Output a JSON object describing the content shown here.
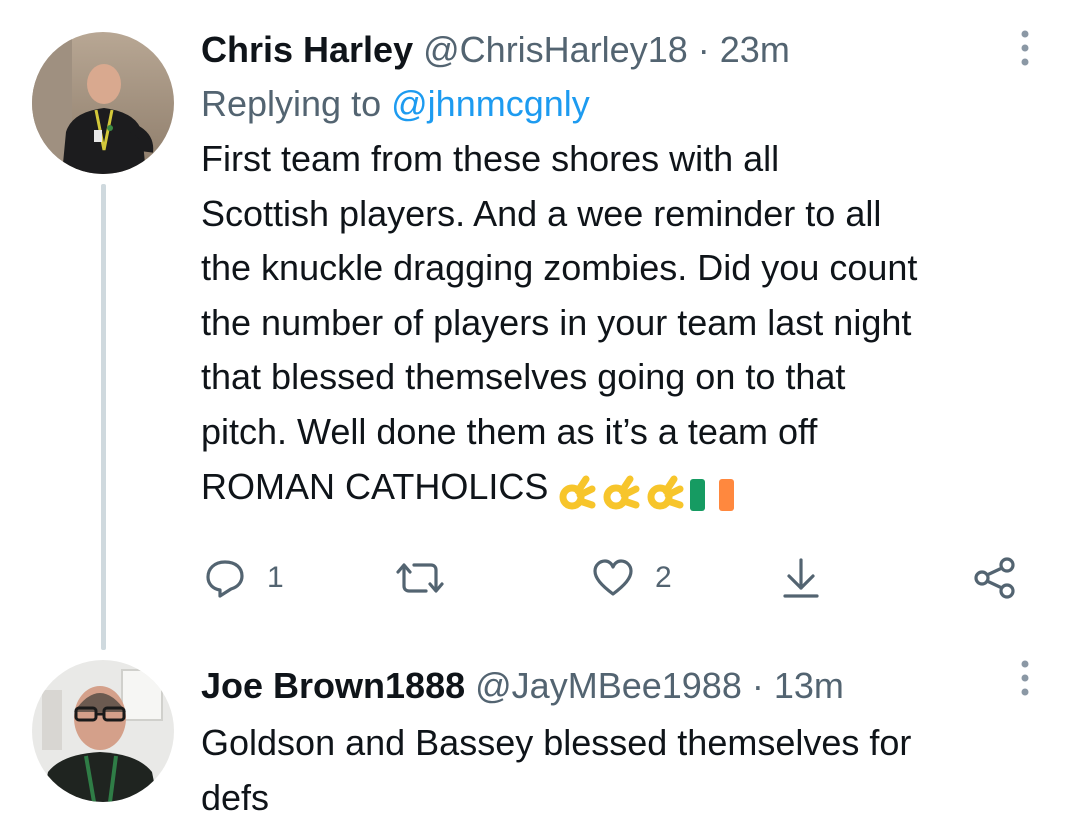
{
  "tweets": [
    {
      "display_name": "Chris Harley",
      "handle": "@ChrisHarley18",
      "separator": "·",
      "time": "23m",
      "replying_prefix": "Replying to",
      "replying_handle": "@jhnmcgnly",
      "text": "First team from these shores with all\nScottish players. And a wee reminder to all\nthe knuckle dragging zombies. Did you count\nthe number of players in your team last night\nthat blessed themselves going on to that\npitch. Well done them as it’s a team off\nROMAN CATHOLICS",
      "emojis": [
        "ok-hand-emoji",
        "ok-hand-emoji",
        "ok-hand-emoji",
        "ireland-flag-emoji"
      ],
      "reply_count": "1",
      "like_count": "2"
    },
    {
      "display_name": "Joe Brown1888",
      "handle": "@JayMBee1988",
      "separator": "·",
      "time": "13m",
      "text": "Goldson and Bassey blessed themselves for\ndefs"
    }
  ],
  "icons": {
    "reply": "reply-icon",
    "retweet": "retweet-icon",
    "like": "like-icon",
    "download": "download-icon",
    "share": "share-icon",
    "more": "more-vertical-icon"
  },
  "colors": {
    "text": "#0f1419",
    "secondary": "#536471",
    "link": "#1d9bf0",
    "thread_line": "#cfd9de"
  }
}
